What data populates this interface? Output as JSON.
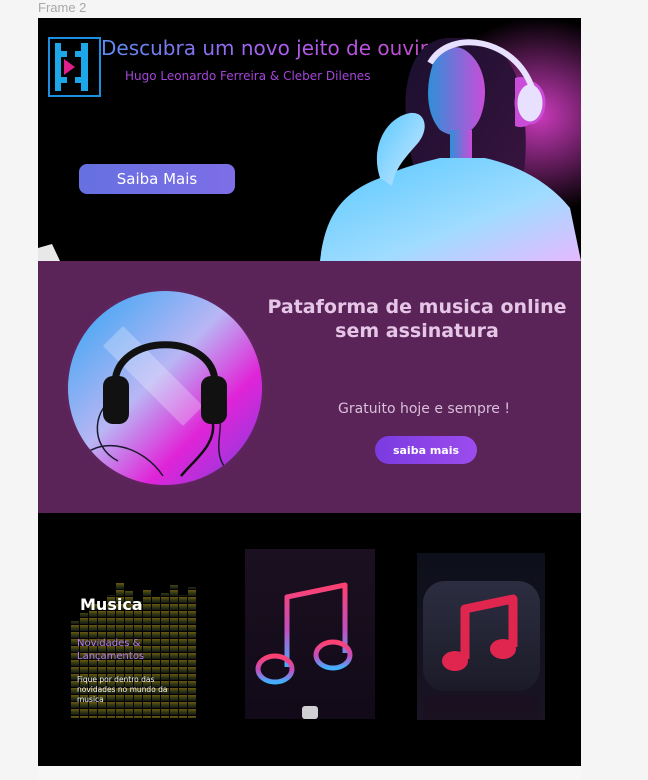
{
  "frame": {
    "label": "Frame 2"
  },
  "hero": {
    "title": "Descubra um novo jeito de ouvir",
    "subtitle": "Hugo Leonardo Ferreira  & Cleber Dilenes",
    "cta_label": "Saiba Mais",
    "logo_icon": "music-player-logo-icon",
    "photo_icon": "woman-with-headphones-photo",
    "colors": {
      "title_start": "#5b8cf2",
      "title_end": "#c24ac8",
      "button": "#6670e0"
    }
  },
  "platform": {
    "title": "Pataforma de musica online sem assinatura",
    "subtitle": "Gratuito hoje e sempre !",
    "cta_label": "saiba mais",
    "image_icon": "headphones-icon",
    "colors": {
      "background": "#5b2459",
      "button": "#8a44e8"
    }
  },
  "cards": [
    {
      "title": "Musica",
      "subtitle": "Novidades & Lançamentos",
      "description": "Fique por dentro das novidades no mundo da musica",
      "icon": "equalizer-icon"
    },
    {
      "icon": "neon-music-note-icon"
    },
    {
      "icon": "music-app-icon"
    }
  ]
}
